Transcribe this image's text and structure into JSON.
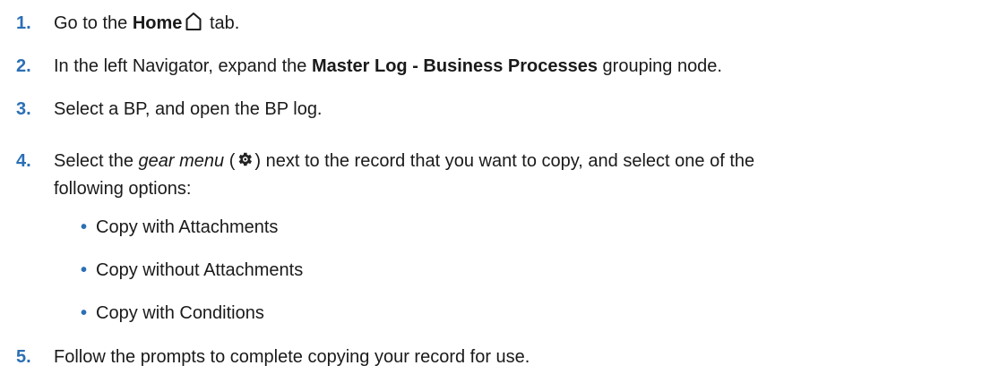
{
  "steps": [
    {
      "num": "1.",
      "pre": "Go to the ",
      "bold": "Home",
      "icon": "home-icon",
      "post": " tab."
    },
    {
      "num": "2.",
      "pre": "In the left Navigator, expand the ",
      "bold": "Master Log - Business Processes",
      "post": " grouping node."
    },
    {
      "num": "3.",
      "text": "Select a BP, and open the BP log."
    },
    {
      "num": "4.",
      "pre": "Select the ",
      "italic": "gear menu",
      "paren_open": " (",
      "icon": "gear-icon",
      "paren_close": ")",
      "post_line1": " next to the record that you want to copy, and select one of the",
      "line2": "following options:",
      "options": [
        "Copy with Attachments",
        "Copy without Attachments",
        "Copy with Conditions"
      ]
    },
    {
      "num": "5.",
      "text": "Follow the prompts to complete copying your record for use."
    }
  ],
  "colors": {
    "accent": "#2b6fb5",
    "text": "#1a1a1a"
  }
}
